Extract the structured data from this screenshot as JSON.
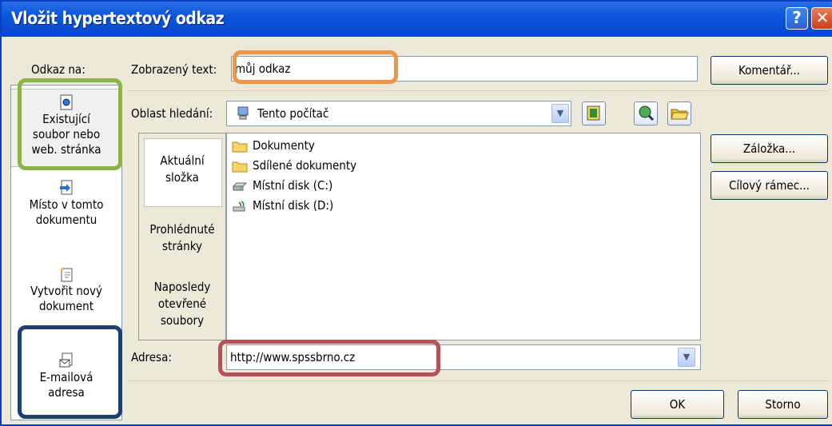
{
  "window": {
    "title": "Vložit hypertextový odkaz",
    "help_glyph": "?",
    "close_glyph": "✕"
  },
  "link_to": {
    "heading": "Odkaz na:",
    "items": [
      {
        "line1": "Existující",
        "line2": "soubor nebo",
        "line3": "web. stránka",
        "icon": "existing-file-icon"
      },
      {
        "line1": "Místo v tomto",
        "line2": "dokumentu",
        "icon": "place-in-document-icon"
      },
      {
        "line1": "Vytvořit nový",
        "line2": "dokument",
        "icon": "new-document-icon"
      },
      {
        "line1": "E-mailová",
        "line2": "adresa",
        "icon": "email-address-icon"
      }
    ]
  },
  "display_text": {
    "label": "Zobrazený text:",
    "value": "můj odkaz"
  },
  "buttons": {
    "comment": "Komentář...",
    "bookmark": "Záložka...",
    "target_frame": "Cílový rámec...",
    "ok": "OK",
    "cancel": "Storno"
  },
  "look_in": {
    "label": "Oblast hledání:",
    "value": "Tento počítač"
  },
  "browse_panel": {
    "items": [
      {
        "line1": "Aktuální",
        "line2": "složka"
      },
      {
        "line1": "Prohlédnuté",
        "line2": "stránky"
      },
      {
        "line1": "Naposledy",
        "line2": "otevřené",
        "line3": "soubory"
      }
    ]
  },
  "files": [
    {
      "name": "Dokumenty",
      "icon": "folder-icon"
    },
    {
      "name": "Sdílené dokumenty",
      "icon": "folder-icon"
    },
    {
      "name": "Místní disk (C:)",
      "icon": "hard-disk-icon"
    },
    {
      "name": "Místní disk (D:)",
      "icon": "removable-disk-icon"
    }
  ],
  "address": {
    "label": "Adresa:",
    "value": "http://www.spssbrno.cz"
  },
  "highlight_colors": {
    "link_to": "#8bb34a",
    "display_text": "#f0944a",
    "email": "#1f3f6e",
    "address": "#b8505a"
  }
}
